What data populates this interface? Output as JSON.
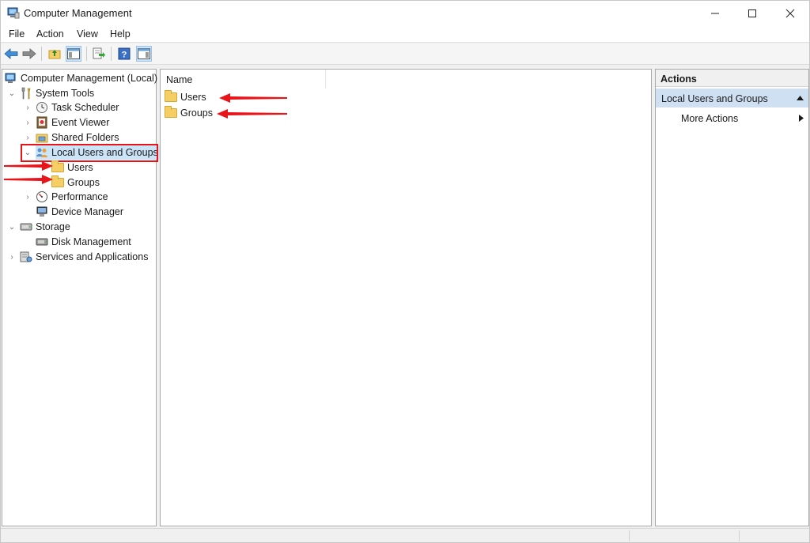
{
  "window": {
    "title": "Computer Management",
    "controls": {
      "minimize": "—",
      "maximize": "☐",
      "close": "✕"
    }
  },
  "menubar": {
    "items": [
      "File",
      "Action",
      "View",
      "Help"
    ]
  },
  "tree": {
    "root": "Computer Management (Local)",
    "system_tools": "System Tools",
    "task_scheduler": "Task Scheduler",
    "event_viewer": "Event Viewer",
    "shared_folders": "Shared Folders",
    "local_users_groups": "Local Users and Groups",
    "users": "Users",
    "groups": "Groups",
    "performance": "Performance",
    "device_manager": "Device Manager",
    "storage": "Storage",
    "disk_management": "Disk Management",
    "services_apps": "Services and Applications"
  },
  "content": {
    "column_name": "Name",
    "items": [
      "Users",
      "Groups"
    ]
  },
  "actions": {
    "header": "Actions",
    "section": "Local Users and Groups",
    "more": "More Actions"
  },
  "colors": {
    "highlight": "#e8141a",
    "arrow": "#e8141a",
    "selection": "#cfe0f3"
  }
}
